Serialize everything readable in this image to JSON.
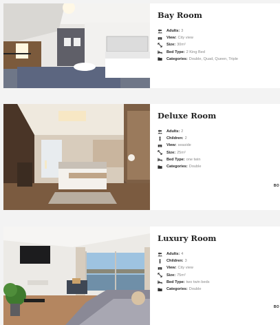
{
  "rooms": [
    {
      "title": "Bay Room",
      "specs": [
        {
          "icon": "adults-icon",
          "key": "Adults:",
          "value": "3"
        },
        {
          "icon": "view-icon",
          "key": "View:",
          "value": "City view"
        },
        {
          "icon": "size-icon",
          "key": "Size:",
          "value": "30m²"
        },
        {
          "icon": "bed-icon",
          "key": "Bed Type:",
          "value": "2 King Bed"
        },
        {
          "icon": "folder-icon",
          "key": "Categories:",
          "value": "Double, Quad, Queen, Triple"
        }
      ]
    },
    {
      "title": "Deluxe Room",
      "more": "BO",
      "specs": [
        {
          "icon": "adults-icon",
          "key": "Adults:",
          "value": "2"
        },
        {
          "icon": "child-icon",
          "key": "Children:",
          "value": "2"
        },
        {
          "icon": "view-icon",
          "key": "View:",
          "value": "seaside"
        },
        {
          "icon": "size-icon",
          "key": "Size:",
          "value": "25m²"
        },
        {
          "icon": "bed-icon",
          "key": "Bed Type:",
          "value": "one twin"
        },
        {
          "icon": "folder-icon",
          "key": "Categories:",
          "value": "Double"
        }
      ]
    },
    {
      "title": "Luxury Room",
      "more": "BO",
      "specs": [
        {
          "icon": "adults-icon",
          "key": "Adults:",
          "value": "4"
        },
        {
          "icon": "child-icon",
          "key": "Children:",
          "value": "3"
        },
        {
          "icon": "view-icon",
          "key": "View:",
          "value": "City view"
        },
        {
          "icon": "size-icon",
          "key": "Size:",
          "value": "75m²"
        },
        {
          "icon": "bed-icon",
          "key": "Bed Type:",
          "value": "two twin beds"
        },
        {
          "icon": "folder-icon",
          "key": "Categories:",
          "value": "Double"
        }
      ]
    }
  ]
}
